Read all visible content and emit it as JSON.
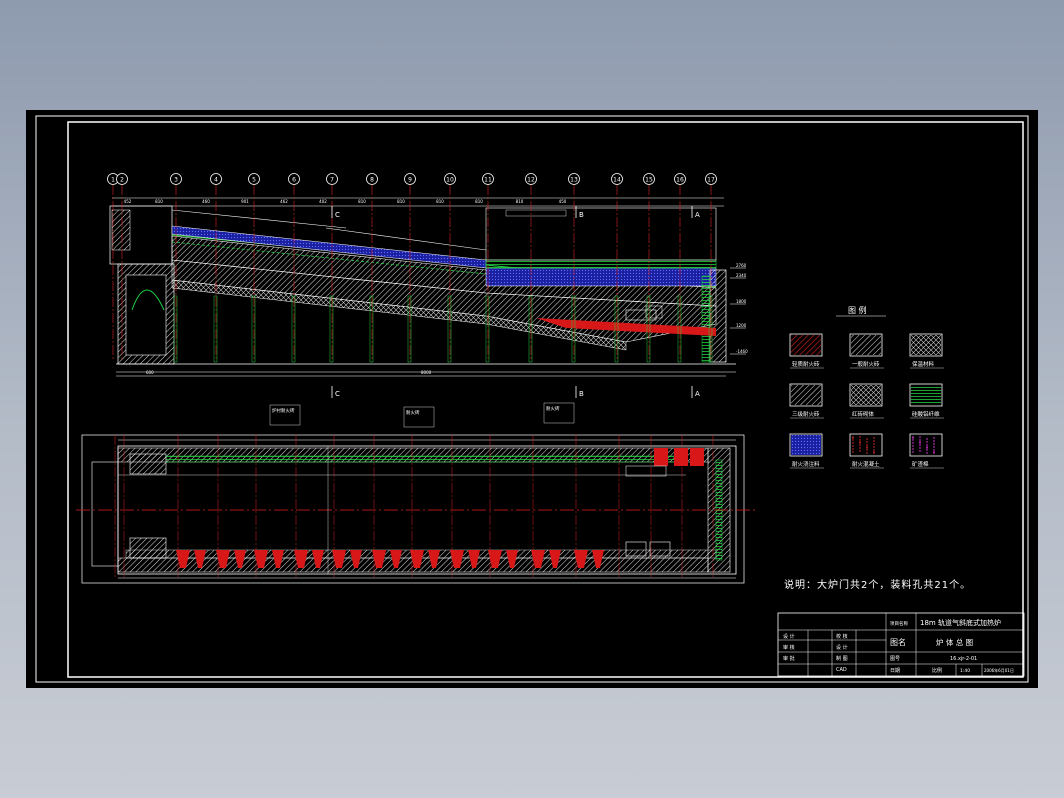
{
  "grid_axes": [
    "1",
    "2",
    "3",
    "4",
    "5",
    "6",
    "7",
    "8",
    "9",
    "10",
    "11",
    "12",
    "13",
    "14",
    "15",
    "16",
    "17"
  ],
  "section_marks": [
    "C",
    "B",
    "A"
  ],
  "dims": {
    "top_segments": [
      "452",
      "810",
      "460",
      "901",
      "462",
      "402",
      "810",
      "810",
      "810",
      "810",
      "810",
      "450"
    ],
    "overall": "8000",
    "left_base": "600",
    "right_levels": [
      "2760",
      "2340",
      "1800",
      "1200",
      "-1460"
    ]
  },
  "legend": {
    "title": "图  例",
    "items": [
      {
        "label": "轻质耐火砖",
        "color": "#d81818",
        "pattern": "diag"
      },
      {
        "label": "一般耐火砖",
        "color": "#ffffff",
        "pattern": "diag"
      },
      {
        "label": "保温材料",
        "color": "#ffffff",
        "pattern": "cross"
      },
      {
        "label": "三级耐火砖",
        "color": "#ffffff",
        "pattern": "diag"
      },
      {
        "label": "红砖砌体",
        "color": "#7fd0ff",
        "pattern": "cross"
      },
      {
        "label": "硅酸铝纤维",
        "color": "#20d040",
        "pattern": "lines"
      },
      {
        "label": "耐火浇注料",
        "color": "#2030ff",
        "pattern": "dots"
      },
      {
        "label": "耐火混凝土",
        "color": "#ff3030",
        "pattern": "dots"
      },
      {
        "label": "矿渣棉",
        "color": "#ff40ff",
        "pattern": "dots"
      }
    ]
  },
  "note": "说明：大炉门共2个，装料孔共21个。",
  "callouts": [
    "炉衬耐火砖",
    "耐火砖",
    "耐火砖"
  ],
  "title_block": {
    "project_label": "项目名称",
    "project_name": "18m 轨道气斜底式加热炉",
    "drawing_label": "图名",
    "drawing_name": "炉 体 总 图",
    "number_label": "图号",
    "number": "16.xjr-2-01",
    "scale_label": "比例",
    "scale": "1:40",
    "date_label": "日期",
    "date": "2006年6月01日",
    "rows": [
      {
        "a": "设  计",
        "b": "校  核"
      },
      {
        "a": "审  核",
        "b": "设  计"
      },
      {
        "a": "审  批",
        "b": "制  图"
      },
      {
        "a": "",
        "b": "CAD"
      }
    ]
  }
}
